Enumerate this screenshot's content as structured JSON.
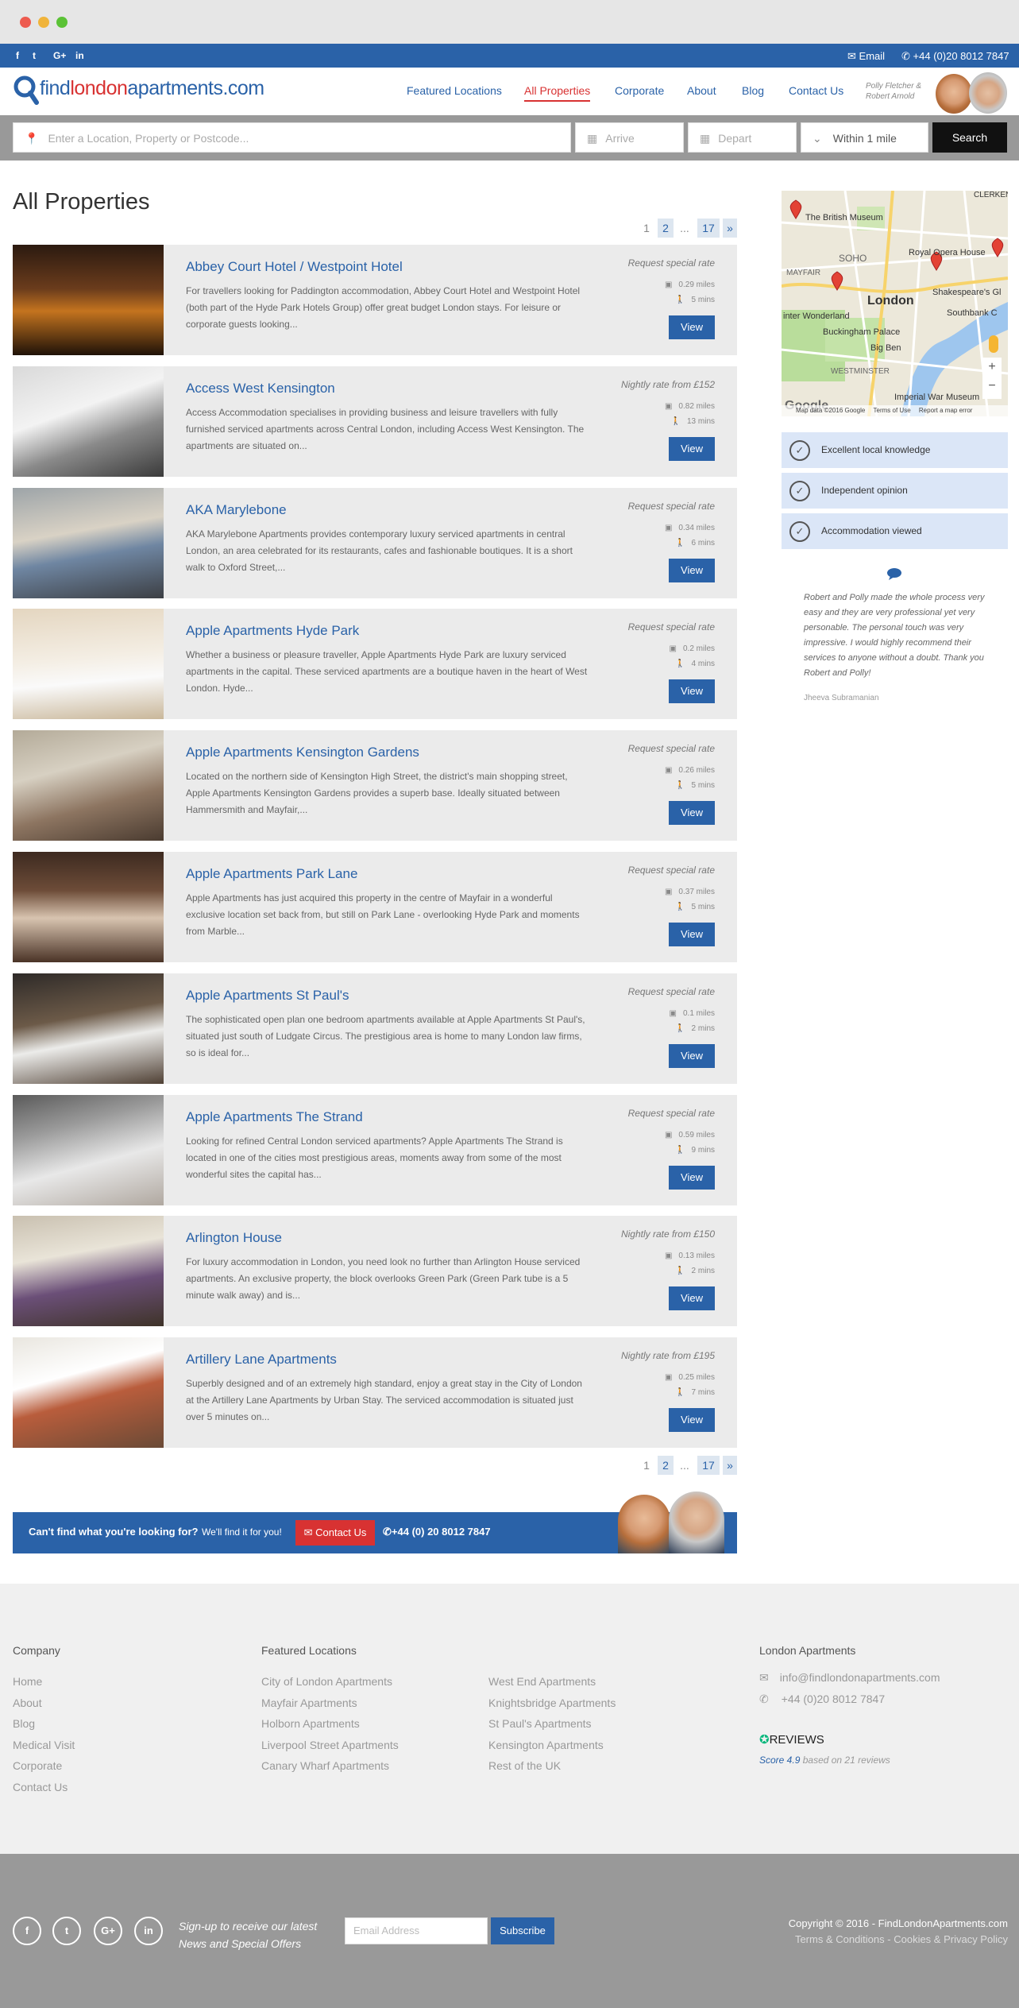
{
  "topbar": {
    "social": [
      "f",
      "t",
      "G+",
      "in"
    ],
    "email": "Email",
    "phone": "+44 (0)20 8012 7847"
  },
  "header": {
    "logo": {
      "part1": "find",
      "part2": "london",
      "part3": "apartments",
      "part4": ".com"
    },
    "nav": [
      "Featured Locations",
      "All Properties",
      "Corporate",
      "About",
      "Blog",
      "Contact Us"
    ],
    "agents_line1": "Polly Fletcher &",
    "agents_line2": "Robert Arnold"
  },
  "search": {
    "location_placeholder": "Enter a Location, Property or Postcode...",
    "arrive": "Arrive",
    "depart": "Depart",
    "radius": "Within 1 mile",
    "button": "Search"
  },
  "page_title": "All Properties",
  "pagination": {
    "p1": "1",
    "p2": "2",
    "ellipsis": "...",
    "last": "17",
    "next": "»"
  },
  "properties": [
    {
      "title": "Abbey Court Hotel / Westpoint Hotel",
      "desc": "For travellers looking for Paddington accommodation, Abbey Court Hotel and Westpoint Hotel (both part of the Hyde Park Hotels Group) offer great budget London stays. For leisure or corporate guests looking...",
      "rate": "Request special rate",
      "miles": "0.29 miles",
      "mins": "5 mins",
      "view": "View"
    },
    {
      "title": "Access West Kensington",
      "desc": "Access Accommodation specialises in providing business and leisure travellers with fully furnished serviced apartments across Central London, including Access West Kensington. The apartments are situated on...",
      "rate": "Nightly rate from £152",
      "miles": "0.82 miles",
      "mins": "13 mins",
      "view": "View"
    },
    {
      "title": "AKA Marylebone",
      "desc": "AKA Marylebone Apartments provides contemporary luxury serviced apartments in central London, an area celebrated for its restaurants, cafes and fashionable boutiques. It is a short walk to Oxford Street,...",
      "rate": "Request special rate",
      "miles": "0.34 miles",
      "mins": "6 mins",
      "view": "View"
    },
    {
      "title": "Apple Apartments Hyde Park",
      "desc": "Whether a business or pleasure traveller, Apple Apartments Hyde Park are luxury serviced apartments in the capital.  These serviced apartments are a boutique haven in the heart of West London.  Hyde...",
      "rate": "Request special rate",
      "miles": "0.2 miles",
      "mins": "4 mins",
      "view": "View"
    },
    {
      "title": "Apple Apartments Kensington Gardens",
      "desc": "Located on the northern side of Kensington High Street, the district's main shopping street, Apple Apartments Kensington Gardens provides a superb base. Ideally situated between Hammersmith and Mayfair,...",
      "rate": "Request special rate",
      "miles": "0.26 miles",
      "mins": "5 mins",
      "view": "View"
    },
    {
      "title": "Apple Apartments Park Lane",
      "desc": "Apple Apartments has just acquired this property in the centre of Mayfair in a wonderful exclusive location set back from, but still on Park Lane - overlooking Hyde Park and moments from Marble...",
      "rate": "Request special rate",
      "miles": "0.37 miles",
      "mins": "5 mins",
      "view": "View"
    },
    {
      "title": "Apple Apartments St Paul's",
      "desc": "The sophisticated open plan one bedroom apartments available at Apple Apartments St Paul's, situated just south of Ludgate Circus. The prestigious area is home to many London law firms, so is ideal for...",
      "rate": "Request special rate",
      "miles": "0.1 miles",
      "mins": "2 mins",
      "view": "View"
    },
    {
      "title": "Apple Apartments The Strand",
      "desc": "Looking for refined Central London serviced apartments? Apple Apartments The Strand is located in one of the cities most prestigious areas, moments away from some of the most wonderful sites the capital has...",
      "rate": "Request special rate",
      "miles": "0.59 miles",
      "mins": "9 mins",
      "view": "View"
    },
    {
      "title": "Arlington House",
      "desc": "For luxury accommodation in London, you need look no further than Arlington House serviced apartments. An exclusive property, the block overlooks Green Park (Green Park tube is a 5 minute walk away) and is...",
      "rate": "Nightly rate from £150",
      "miles": "0.13 miles",
      "mins": "2 mins",
      "view": "View"
    },
    {
      "title": "Artillery Lane Apartments",
      "desc": "Superbly designed and of an extremely high standard, enjoy a great stay in the City of London at the Artillery Lane Apartments by Urban Stay. The serviced accommodation is situated just over 5 minutes on...",
      "rate": "Nightly rate from £195",
      "miles": "0.25 miles",
      "mins": "7 mins",
      "view": "View"
    }
  ],
  "map": {
    "labels": [
      "CLERKEN",
      "The British Museum",
      "SOHO",
      "MAYFAIR",
      "Royal Opera House",
      "London",
      "Shakespeare's Gl",
      "inter Wonderland",
      "Southbank C",
      "Buckingham Palace",
      "Big Ben",
      "WESTMINSTER",
      "Imperial War Museum"
    ],
    "footer": [
      "Map data ©2016 Google",
      "Terms of Use",
      "Report a map error"
    ],
    "google": "Google",
    "zoom_in": "+",
    "zoom_out": "−"
  },
  "features": [
    "Excellent local knowledge",
    "Independent opinion",
    "Accommodation viewed"
  ],
  "testimonial": {
    "text": "Robert and Polly made the whole process very easy and they are very professional yet very personable. The personal touch was very impressive. I would highly recommend their services to anyone without a doubt. Thank you Robert and Polly!",
    "author": "Jheeva Subramanian"
  },
  "cta": {
    "headline": "Can't find what you're looking for?",
    "sub": "We'll find it for you!",
    "button": "Contact Us",
    "phone": "+44 (0) 20 8012 7847"
  },
  "footer": {
    "company_heading": "Company",
    "company_links": [
      "Home",
      "About",
      "Blog",
      "Medical Visit",
      "Corporate",
      "Contact Us"
    ],
    "featured_heading": "Featured Locations",
    "featured_col1": [
      "City of London Apartments",
      "Mayfair Apartments",
      "Holborn Apartments",
      "Liverpool Street Apartments",
      "Canary Wharf Apartments"
    ],
    "featured_col2": [
      "West End Apartments",
      "Knightsbridge Apartments",
      "St Paul's Apartments",
      "Kensington Apartments",
      "Rest of the UK"
    ],
    "london_heading": "London Apartments",
    "email": "info@findlondonapartments.com",
    "phone": "+44 (0)20 8012 7847",
    "reviews_label": "REVIEWS",
    "score": "Score 4.9",
    "based_on": "based on 21 reviews"
  },
  "bottom": {
    "social": [
      "f",
      "t",
      "G+",
      "in"
    ],
    "signup_line1": "Sign-up to receive our latest",
    "signup_line2": "News and Special Offers",
    "email_placeholder": "Email Address",
    "subscribe": "Subscribe",
    "copyright": "Copyright © 2016 - FindLondonApartments.com",
    "terms": "Terms & Conditions",
    "sep": " - ",
    "privacy": "Cookies & Privacy Policy"
  },
  "colors": {
    "brand_blue": "#2a62a8",
    "accent_red": "#d83232",
    "card_bg": "#ebebeb",
    "feature_bg": "#dbe6f7",
    "footer_dark": "#999999"
  }
}
